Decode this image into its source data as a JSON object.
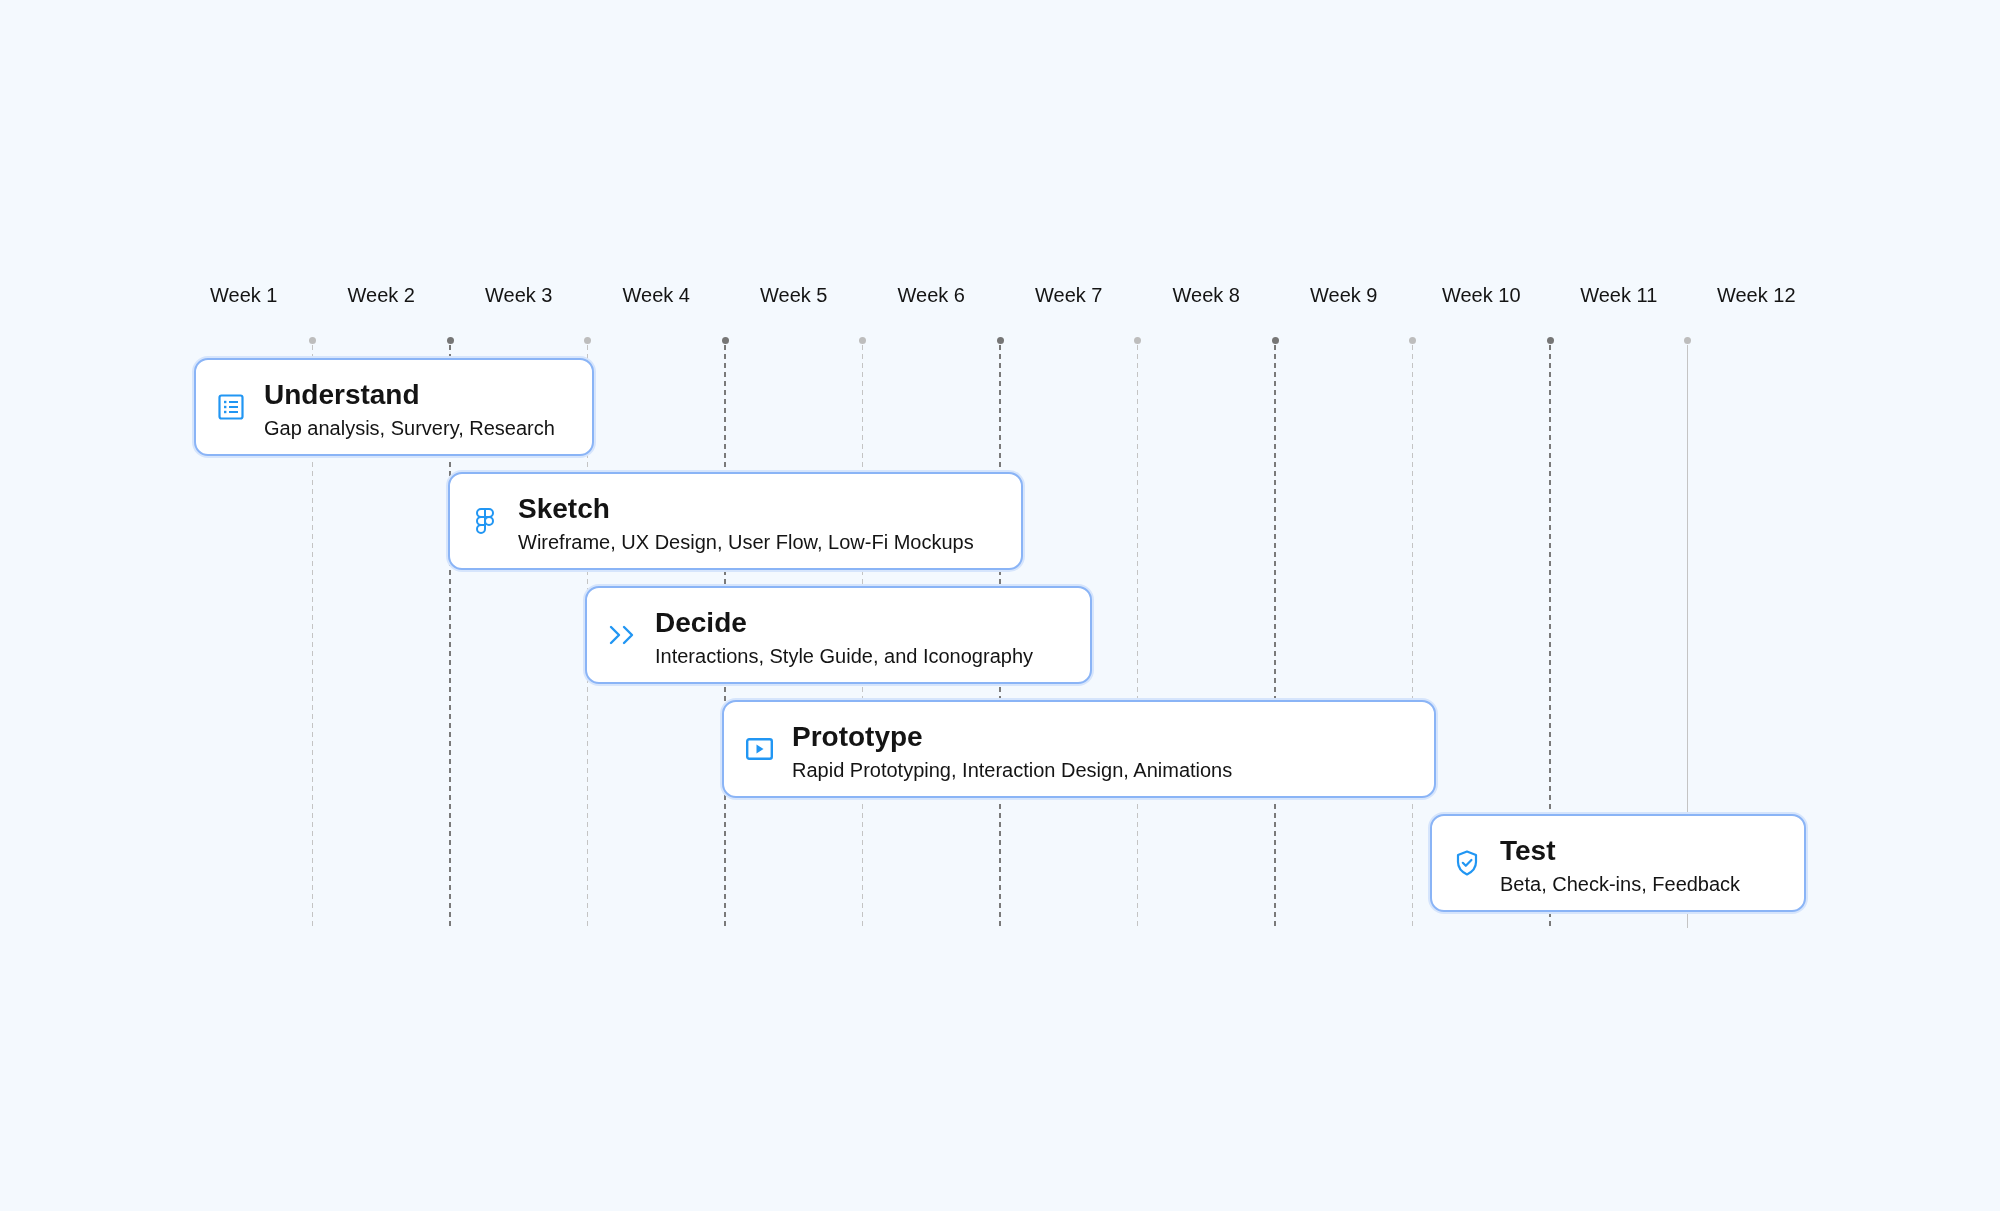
{
  "weeks": [
    "Week 1",
    "Week 2",
    "Week 3",
    "Week 4",
    "Week 5",
    "Week 6",
    "Week 7",
    "Week 8",
    "Week 9",
    "Week 10",
    "Week 11",
    "Week 12"
  ],
  "gridlines": [
    {
      "kind": "faint"
    },
    {
      "kind": "dark"
    },
    {
      "kind": "faint"
    },
    {
      "kind": "dark"
    },
    {
      "kind": "faint"
    },
    {
      "kind": "dark"
    },
    {
      "kind": "faint"
    },
    {
      "kind": "dark"
    },
    {
      "kind": "faint"
    },
    {
      "kind": "dark"
    },
    {
      "kind": "solid"
    }
  ],
  "phases": [
    {
      "title": "Understand",
      "details": "Gap analysis, Survery, Research"
    },
    {
      "title": "Sketch",
      "details": "Wireframe, UX Design, User Flow, Low-Fi Mockups"
    },
    {
      "title": "Decide",
      "details": "Interactions, Style Guide, and Iconography"
    },
    {
      "title": "Prototype",
      "details": "Rapid Prototyping, Interaction Design, Animations"
    },
    {
      "title": "Test",
      "details": "Beta, Check-ins, Feedback"
    }
  ]
}
